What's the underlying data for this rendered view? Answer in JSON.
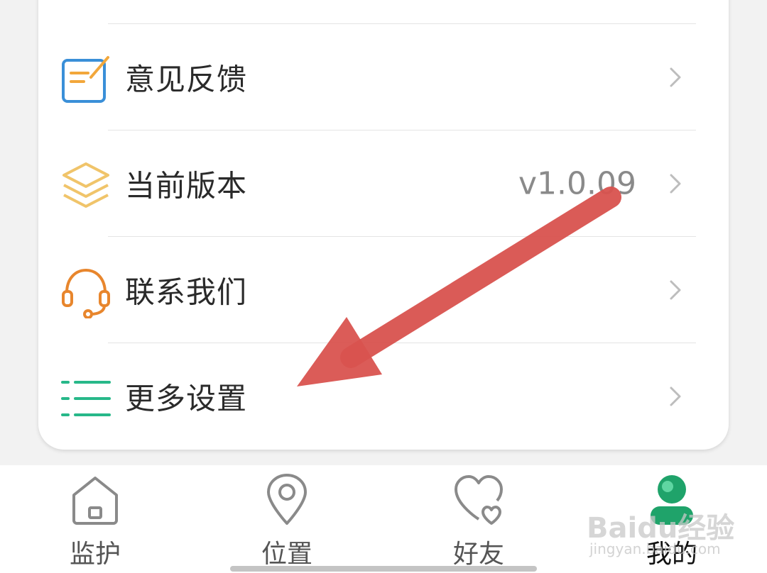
{
  "menu": {
    "items": [
      {
        "label": "意见反馈",
        "icon": "feedback-icon",
        "value": ""
      },
      {
        "label": "当前版本",
        "icon": "layers-icon",
        "value": "v1.0.09"
      },
      {
        "label": "联系我们",
        "icon": "headset-icon",
        "value": ""
      },
      {
        "label": "更多设置",
        "icon": "list-icon",
        "value": ""
      }
    ]
  },
  "tabbar": {
    "tabs": [
      {
        "label": "监护",
        "icon": "home-icon",
        "active": false
      },
      {
        "label": "位置",
        "icon": "location-pin-icon",
        "active": false
      },
      {
        "label": "好友",
        "icon": "heart-icon",
        "active": false
      },
      {
        "label": "我的",
        "icon": "user-icon",
        "active": true
      }
    ]
  },
  "watermark": {
    "brand": "Baidu经验",
    "site": "jingyan.baidu.com"
  },
  "colors": {
    "accent_green": "#1fa36a",
    "annotation_arrow": "#d9534f",
    "feedback_blue": "#3a8fd8",
    "feedback_orange": "#f2a73b",
    "layers_yellow": "#f0c46a",
    "headset_orange": "#e8862d",
    "list_green": "#27b889"
  }
}
